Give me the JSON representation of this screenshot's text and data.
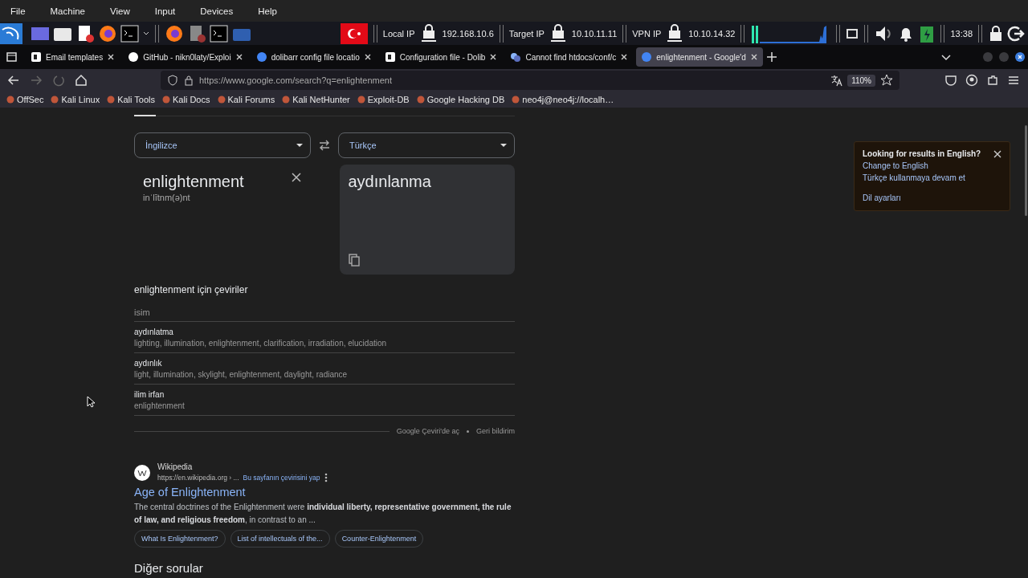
{
  "menubar": [
    "File",
    "Machine",
    "View",
    "Input",
    "Devices",
    "Help"
  ],
  "panel": {
    "indicators": [
      {
        "label": "Local IP",
        "value": "192.168.10.6"
      },
      {
        "label": "Target IP",
        "value": "10.10.11.11"
      },
      {
        "label": "VPN IP",
        "value": "10.10.14.32"
      }
    ],
    "clock": "13:38"
  },
  "tabs": [
    {
      "title": "Email templates",
      "kind": "dolibarr",
      "selected": false
    },
    {
      "title": "GitHub - nikn0laty/Exploi",
      "kind": "github",
      "selected": false
    },
    {
      "title": "dolibarr config file locatio",
      "kind": "google",
      "selected": false
    },
    {
      "title": "Configuration file - Dolib",
      "kind": "dolibarr",
      "selected": false
    },
    {
      "title": "Cannot find htdocs/conf/c",
      "kind": "forum",
      "selected": false
    },
    {
      "title": "enlightenment - Google'd",
      "kind": "google",
      "selected": true
    }
  ],
  "address_bar": {
    "url": "https://www.google.com/search?q=enlightenment",
    "zoom": "110%"
  },
  "bookmarks": [
    "OffSec",
    "Kali Linux",
    "Kali Tools",
    "Kali Docs",
    "Kali Forums",
    "Kali NetHunter",
    "Exploit-DB",
    "Google Hacking DB",
    "neo4j@neo4j://localh…"
  ],
  "translate": {
    "source_language": "İngilizce",
    "target_language": "Türkçe",
    "source_text": "enlightenment",
    "phonetic": "inˈlītnm(ə)nt",
    "translation": "aydınlanma",
    "heading": "enlightenment için çeviriler",
    "part_of_speech": "isim",
    "entries": [
      {
        "word": "aydınlatma",
        "synonyms": "lighting, illumination, enlightenment, clarification, irradiation, elucidation"
      },
      {
        "word": "aydınlık",
        "synonyms": "light, illumination, skylight, enlightenment, daylight, radiance"
      },
      {
        "word": "ilim irfan",
        "synonyms": "enlightenment"
      }
    ],
    "footer_links": [
      "Google Çeviri'de aç",
      "Geri bildirim"
    ]
  },
  "result": {
    "source": "Wikipedia",
    "url": "https://en.wikipedia.org › ...",
    "translate_link": "Bu sayfanın çevirisini yap",
    "title": "Age of Enlightenment",
    "snippet": "The central doctrines of the Enlightenment were **individual liberty, representative government, the rule of law, and religious freedom**, in contrast to an ...",
    "chips": [
      "What Is Enlightenment?",
      "List of intellectuals of the...",
      "Counter-Enlightenment"
    ]
  },
  "more_questions": "Diğer sorular",
  "language_prompt": {
    "title": "Looking for results in English?",
    "options": [
      "Change to English",
      "Türkçe kullanmaya devam et"
    ],
    "settings_link": "Dil ayarları"
  }
}
